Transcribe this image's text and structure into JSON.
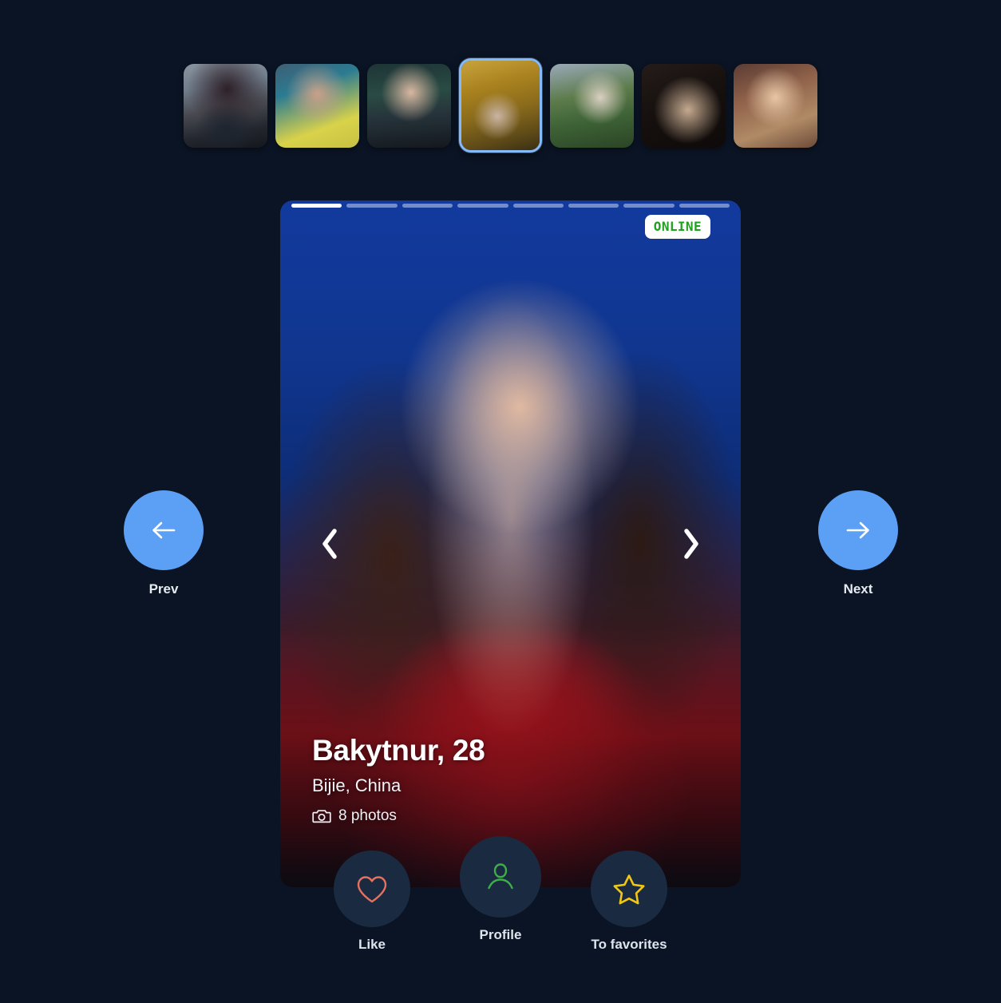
{
  "background_color": "#0b1424",
  "accent_color": "#5ca0f5",
  "thumbnails": {
    "selected_index": 3,
    "items": [
      {
        "alt": "thumbnail-photo-1",
        "style": "ph-a"
      },
      {
        "alt": "thumbnail-photo-2",
        "style": "ph-b"
      },
      {
        "alt": "thumbnail-photo-3",
        "style": "ph-c"
      },
      {
        "alt": "thumbnail-photo-4",
        "style": "ph-d"
      },
      {
        "alt": "thumbnail-photo-5",
        "style": "ph-e"
      },
      {
        "alt": "thumbnail-photo-6",
        "style": "ph-f"
      },
      {
        "alt": "thumbnail-photo-7",
        "style": "ph-g"
      }
    ]
  },
  "card": {
    "progress": {
      "total": 8,
      "active_index": 0
    },
    "status_badge": {
      "label": "ONLINE",
      "text_color": "#20a020",
      "background_color": "#ffffff"
    },
    "name": "Bakytnur, 28",
    "location": "Bijie, China",
    "photo_count": "8 photos",
    "photo_icon": "camera-icon",
    "prev_photo_icon": "chevron-left-icon",
    "next_photo_icon": "chevron-right-icon"
  },
  "side_nav": {
    "prev": {
      "label": "Prev",
      "icon": "arrow-left-icon"
    },
    "next": {
      "label": "Next",
      "icon": "arrow-right-icon"
    }
  },
  "actions": [
    {
      "label": "Like",
      "icon": "heart-icon",
      "color": "#e8705f"
    },
    {
      "label": "Profile",
      "icon": "person-icon",
      "color": "#3fae49"
    },
    {
      "label": "To favorites",
      "icon": "star-icon",
      "color": "#f2c80f"
    }
  ]
}
